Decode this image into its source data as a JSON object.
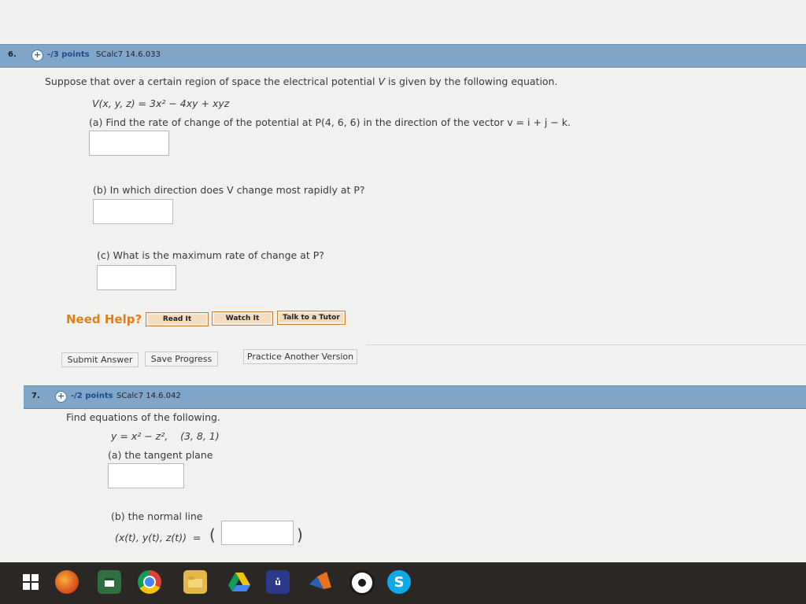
{
  "q6": {
    "number": "6.",
    "plus": "+",
    "points": "-/3 points",
    "code": "SCalc7 14.6.033",
    "intro_pre": "Suppose that over a certain region of space the electrical potential ",
    "intro_var": "V",
    "intro_post": " is given by the following equation.",
    "equation": "V(x, y, z) = 3x² − 4xy + xyz",
    "part_a": "(a) Find the rate of change of the potential at P(4, 6, 6) in the direction of the vector v = i + j − k.",
    "part_b": "(b) In which direction does V change most rapidly at P?",
    "part_c": "(c) What is the maximum rate of change at P?",
    "need_help": "Need Help?",
    "read_it": "Read It",
    "watch_it": "Watch It",
    "talk_tutor": "Talk to a Tutor",
    "submit": "Submit Answer",
    "save": "Save Progress",
    "practice": "Practice Another Version"
  },
  "q7": {
    "number": "7.",
    "plus": "+",
    "points": "-/2 points",
    "code": "SCalc7 14.6.042",
    "intro": "Find equations of the following.",
    "equation": "y = x² − z²,    (3, 8, 1)",
    "part_a": "(a) the tangent plane",
    "part_b": "(b) the normal line",
    "param": "(x(t), y(t), z(t))  =",
    "paren_open": "(",
    "paren_close": ")"
  },
  "taskbar": {
    "icons": [
      "windows-start-icon",
      "firefox-icon",
      "calendar-app-icon",
      "chrome-icon",
      "file-explorer-icon",
      "google-drive-icon",
      "media-app-icon",
      "matlab-icon",
      "steam-icon",
      "skype-icon"
    ]
  }
}
